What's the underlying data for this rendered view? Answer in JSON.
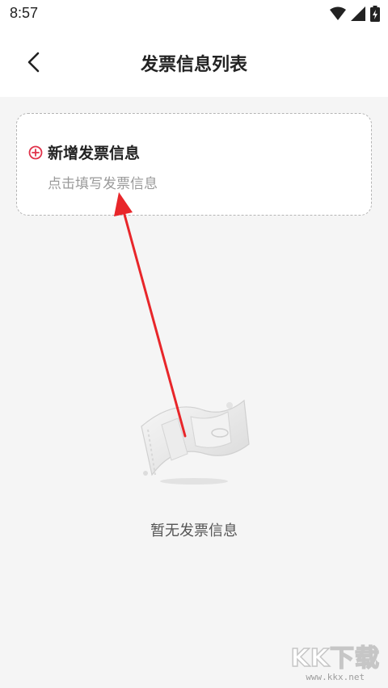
{
  "status_bar": {
    "time": "8:57"
  },
  "header": {
    "title": "发票信息列表"
  },
  "add_card": {
    "title": "新增发票信息",
    "subtitle": "点击填写发票信息"
  },
  "empty_state": {
    "text": "暂无发票信息"
  },
  "watermark": {
    "logo": "KK下载",
    "url": "www.kkx.net"
  },
  "colors": {
    "accent": "#e0324a",
    "arrow": "#e8262a",
    "background": "#f5f5f5"
  },
  "icons": [
    "wifi-icon",
    "signal-icon",
    "battery-icon",
    "back-arrow-icon",
    "plus-circle-icon",
    "empty-ticket-icon"
  ]
}
